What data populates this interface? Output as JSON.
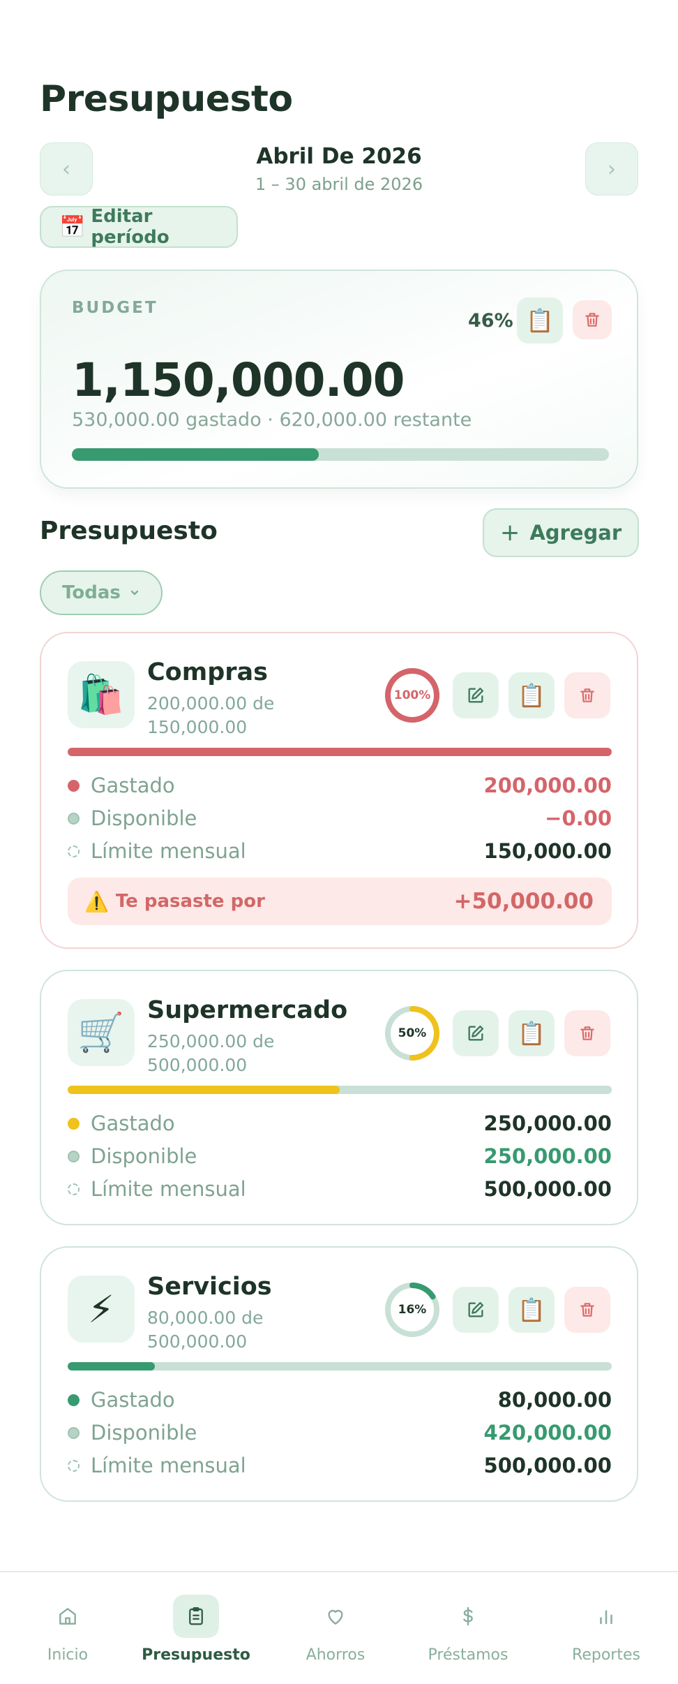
{
  "header": {
    "title": "Presupuesto",
    "period_title": "Abril De 2026",
    "period_range": "1 – 30 abril de 2026",
    "prev_icon": "‹",
    "next_icon": "›",
    "edit_period_emoji": "📅",
    "edit_period_label": "Editar período"
  },
  "budget": {
    "label": "BUDGET",
    "percent": "46%",
    "percent_value": 46,
    "amount": "1,150,000.00",
    "summary": "530,000.00 gastado · 620,000.00 restante",
    "copy_icon": "📋",
    "delete_icon": "trash-icon"
  },
  "section": {
    "title": "Presupuesto",
    "add_label": "Agregar",
    "add_icon": "+",
    "filter_label": "Todas",
    "filter_chevron": "⌄"
  },
  "categories": [
    {
      "emoji": "🛍️",
      "name": "Compras",
      "sub": "200,000.00 de 150,000.00",
      "ring_label": "100%",
      "percent": 100,
      "color": "#d5646a",
      "spent_label": "Gastado",
      "spent": "200,000.00",
      "available_label": "Disponible",
      "available": "−0.00",
      "limit_label": "Límite mensual",
      "limit": "150,000.00",
      "over_emoji": "⚠️",
      "over_label": "Te pasaste por",
      "over_value": "+50,000.00"
    },
    {
      "emoji": "🛒",
      "name": "Supermercado",
      "sub": "250,000.00 de 500,000.00",
      "ring_label": "50%",
      "percent": 50,
      "color": "#efc21c",
      "spent_label": "Gastado",
      "spent": "250,000.00",
      "available_label": "Disponible",
      "available": "250,000.00",
      "limit_label": "Límite mensual",
      "limit": "500,000.00"
    },
    {
      "emoji": "⚡",
      "name": "Servicios",
      "sub": "80,000.00 de 500,000.00",
      "ring_label": "16%",
      "percent": 16,
      "color": "#379a70",
      "spent_label": "Gastado",
      "spent": "80,000.00",
      "available_label": "Disponible",
      "available": "420,000.00",
      "limit_label": "Límite mensual",
      "limit": "500,000.00"
    }
  ],
  "nav": {
    "tabs": [
      {
        "label": "Inicio",
        "icon": "home-icon"
      },
      {
        "label": "Presupuesto",
        "icon": "clipboard-icon",
        "active": true
      },
      {
        "label": "Ahorros",
        "icon": "heart-icon"
      },
      {
        "label": "Préstamos",
        "icon": "dollar-icon"
      },
      {
        "label": "Reportes",
        "icon": "bar-chart-icon"
      }
    ]
  },
  "colors": {
    "accent": "#379a70",
    "danger": "#d5646a",
    "warning": "#efc21c",
    "text_dark": "#1e3428",
    "text_muted": "#83a899"
  }
}
